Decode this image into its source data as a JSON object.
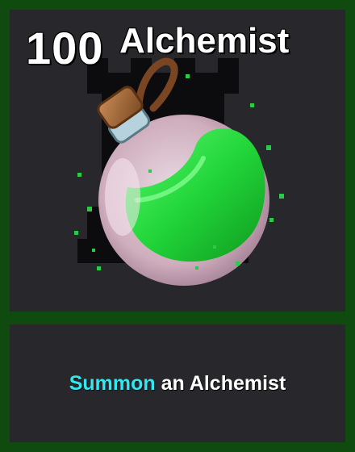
{
  "card": {
    "cost": "100",
    "title": "Alchemist",
    "description_keyword": "Summon",
    "description_rest": " an Alchemist"
  },
  "icons": {
    "art": "potion-icon",
    "background": "tower-silhouette-icon"
  },
  "colors": {
    "frame": "#0f4a0f",
    "panel": "#28282c",
    "keyword": "#33e6f0",
    "potion_liquid": "#22d63a"
  }
}
